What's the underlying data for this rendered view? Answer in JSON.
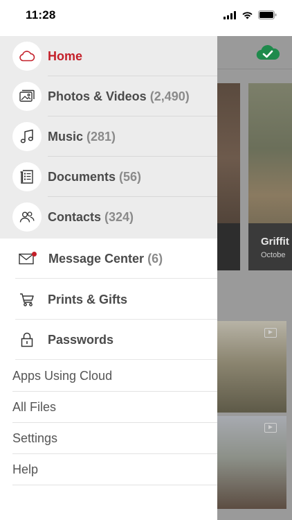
{
  "status_bar": {
    "time": "11:28"
  },
  "background": {
    "card_title": "Griffit",
    "card_subtitle": "Octobe"
  },
  "drawer": {
    "primary_items": [
      {
        "label": "Home",
        "count": "",
        "icon": "cloud-icon",
        "active": true
      },
      {
        "label": "Photos & Videos",
        "count": "(2,490)",
        "icon": "photos-icon"
      },
      {
        "label": "Music",
        "count": "(281)",
        "icon": "music-icon"
      },
      {
        "label": "Documents",
        "count": "(56)",
        "icon": "documents-icon"
      },
      {
        "label": "Contacts",
        "count": "(324)",
        "icon": "contacts-icon"
      }
    ],
    "secondary_items": [
      {
        "label": "Message Center",
        "count": "(6)",
        "icon": "mail-icon",
        "has_badge": true
      },
      {
        "label": "Prints & Gifts",
        "count": "",
        "icon": "cart-icon"
      },
      {
        "label": "Passwords",
        "count": "",
        "icon": "lock-icon"
      }
    ],
    "text_items": [
      {
        "label": "Apps Using Cloud"
      },
      {
        "label": "All Files"
      },
      {
        "label": "Settings"
      },
      {
        "label": "Help"
      }
    ]
  },
  "colors": {
    "accent": "#c4202a",
    "cloud_green": "#1f8a4c",
    "drawer_highlight": "#ececec",
    "overlay": "#9a9a9a"
  }
}
